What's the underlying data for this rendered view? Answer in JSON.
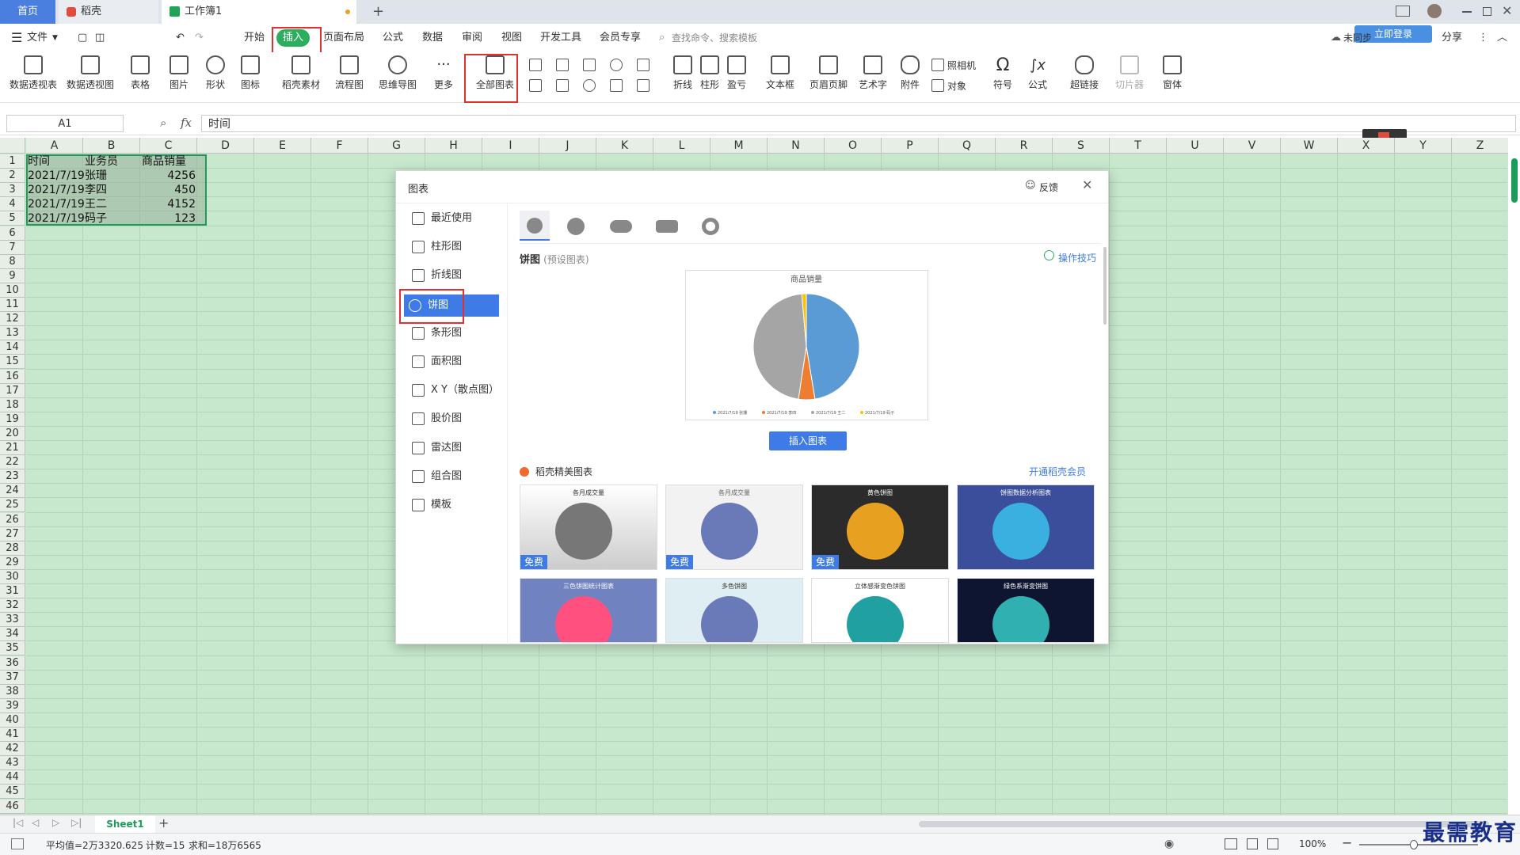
{
  "tabs": {
    "home": "首页",
    "daoke": "稻壳",
    "book": "工作簿1",
    "add": "+"
  },
  "menu": {
    "file": "文件",
    "items": [
      "开始",
      "插入",
      "页面布局",
      "公式",
      "数据",
      "审阅",
      "视图",
      "开发工具",
      "会员专享"
    ],
    "search": "查找命令、搜索模板",
    "sync": "未同步",
    "share": "分享",
    "login": "立即登录"
  },
  "ribbon": {
    "pivot_table": "数据透视表",
    "pivot_chart": "数据透视图",
    "table": "表格",
    "picture": "图片",
    "shape": "形状",
    "icon": "图标",
    "daoke_material": "稻壳素材",
    "flowchart": "流程图",
    "mindmap": "思维导图",
    "more": "更多",
    "all_charts": "全部图表",
    "line": "折线",
    "bar": "柱形",
    "winloss": "盈亏",
    "textbox": "文本框",
    "header_footer": "页眉页脚",
    "wordart": "艺术字",
    "attachment": "附件",
    "camera": "照相机",
    "object": "对象",
    "symbol": "符号",
    "formula": "公式",
    "hyperlink": "超链接",
    "slicer": "切片器",
    "window": "窗体"
  },
  "formula_bar": {
    "cell_ref": "A1",
    "fx": "fx",
    "content": "时间"
  },
  "columns": [
    "A",
    "B",
    "C",
    "D",
    "E",
    "F",
    "G",
    "H",
    "I",
    "J",
    "K",
    "L",
    "M",
    "N",
    "O",
    "P",
    "Q",
    "R",
    "S",
    "T",
    "U",
    "V",
    "W",
    "X",
    "Y",
    "Z"
  ],
  "rows": [
    "1",
    "2",
    "3",
    "4",
    "5",
    "6",
    "7",
    "8",
    "9",
    "10",
    "11",
    "12",
    "13",
    "14",
    "15",
    "16",
    "17",
    "18",
    "19",
    "20",
    "21",
    "22",
    "23",
    "24",
    "25",
    "26",
    "27",
    "28",
    "29",
    "30",
    "31",
    "32",
    "33",
    "34",
    "35",
    "36",
    "37",
    "38",
    "39",
    "40",
    "41",
    "42",
    "43",
    "44",
    "45",
    "46"
  ],
  "table": {
    "headers": [
      "时间",
      "业务员",
      "商品销量"
    ],
    "rows": [
      [
        "2021/7/19",
        "张珊",
        "4256"
      ],
      [
        "2021/7/19",
        "李四",
        "450"
      ],
      [
        "2021/7/19",
        "王二",
        "4152"
      ],
      [
        "2021/7/19",
        "码子",
        "123"
      ]
    ]
  },
  "dialog": {
    "title": "图表",
    "feedback": "反馈",
    "sidebar": [
      "最近使用",
      "柱形图",
      "折线图",
      "饼图",
      "条形图",
      "面积图",
      "X Y（散点图）",
      "股价图",
      "雷达图",
      "组合图",
      "模板"
    ],
    "section_title": "饼图",
    "section_sub": "(预设图表)",
    "tips": "操作技巧",
    "insert_button": "插入图表",
    "premium_title": "稻壳精美图表",
    "open_member": "开通稻壳会员",
    "free_badge": "免费",
    "thumbs": [
      "各月成交量",
      "各月成交量",
      "黄色饼图",
      "饼图数据分析图表",
      "三色饼图统计图表",
      "多色饼图",
      "立体感渐变色饼图",
      "绿色系渐变饼图"
    ]
  },
  "chart_data": {
    "type": "pie",
    "title": "商品销量",
    "categories": [
      "2021/7/19 张珊",
      "2021/7/19 李四",
      "2021/7/19 王二",
      "2021/7/19 码子"
    ],
    "values": [
      4256,
      450,
      4152,
      123
    ],
    "colors": [
      "#5b9bd5",
      "#ed7d31",
      "#a5a5a5",
      "#ffc000"
    ],
    "legend": "bottom"
  },
  "sheet": {
    "name": "Sheet1",
    "add": "+"
  },
  "status": {
    "avg": "平均值=2万3320.625",
    "count": "计数=15",
    "sum": "求和=18万6565",
    "zoom": "100%"
  },
  "watermark": "最需教育"
}
